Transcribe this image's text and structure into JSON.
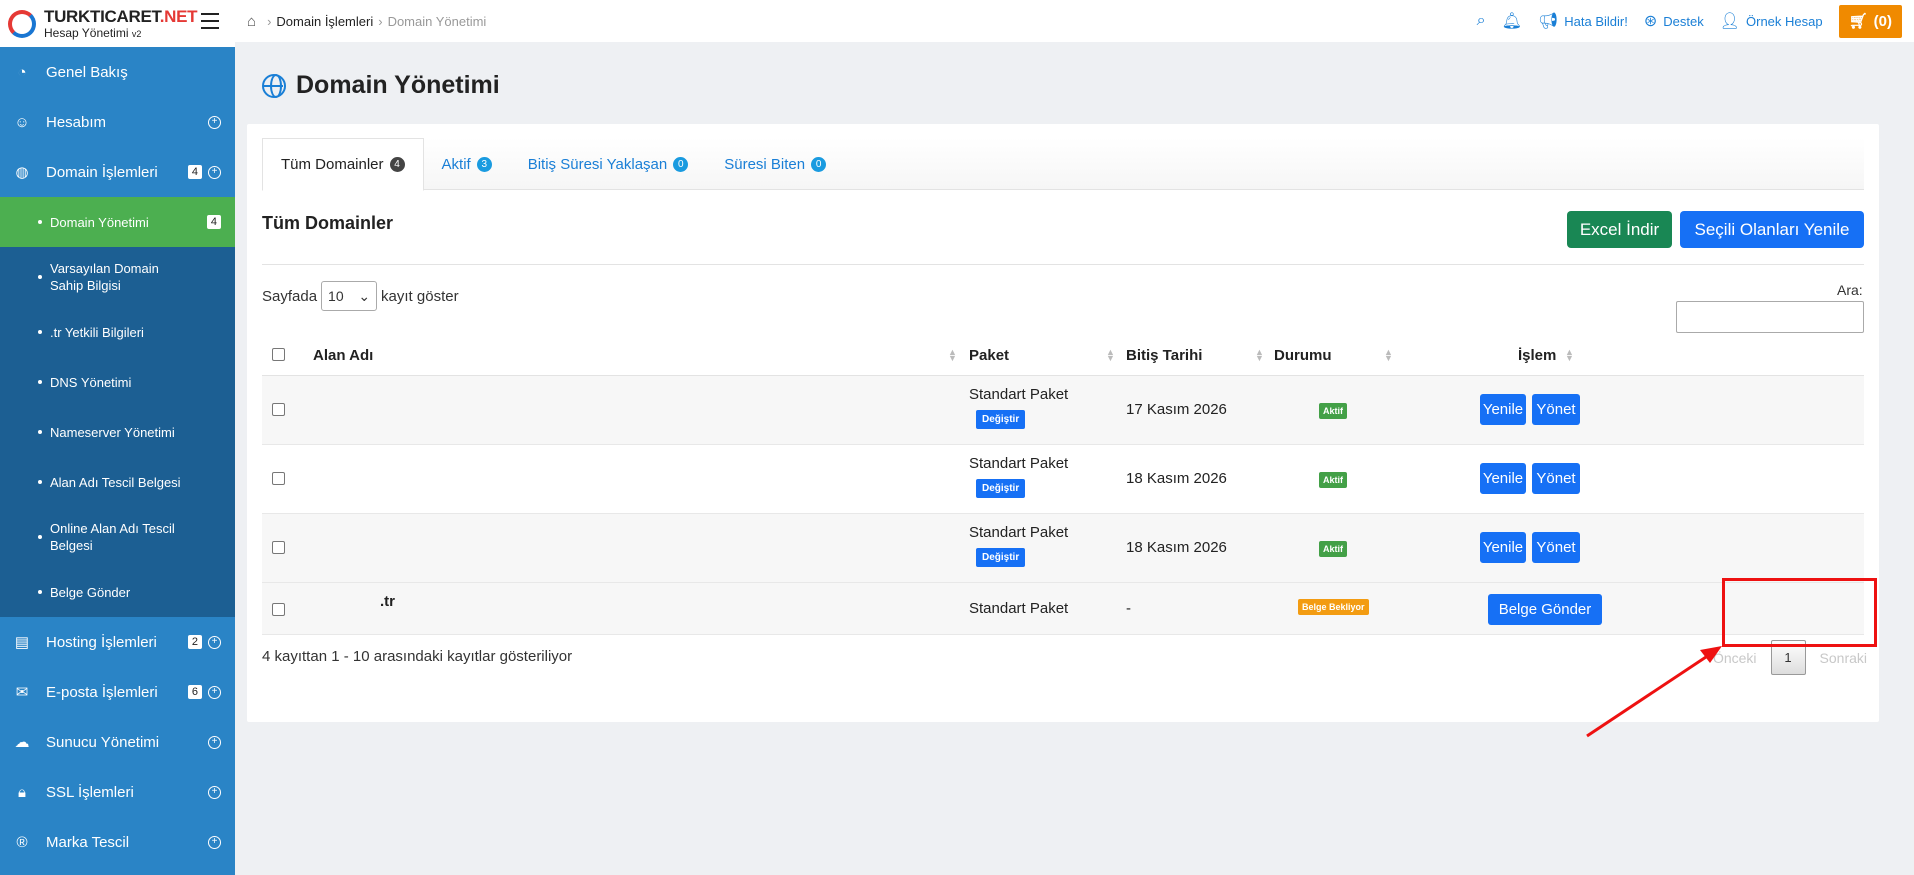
{
  "logo": {
    "name": "TURKTICARET",
    "name_suffix": ".NET",
    "subtitle": "Hesap Yönetimi",
    "version": "v2"
  },
  "sidebar": {
    "items": [
      {
        "label": "Genel Bakış",
        "icon": "gauge-icon"
      },
      {
        "label": "Hesabım",
        "icon": "user-icon"
      },
      {
        "label": "Domain İşlemleri",
        "icon": "globe-icon",
        "badge": "4"
      },
      {
        "label": "Hosting İşlemleri",
        "icon": "server-icon",
        "badge": "2"
      },
      {
        "label": "E-posta İşlemleri",
        "icon": "envelope-icon",
        "badge": "6"
      },
      {
        "label": "Sunucu Yönetimi",
        "icon": "cloud-icon"
      },
      {
        "label": "SSL İşlemleri",
        "icon": "lock-icon"
      },
      {
        "label": "Marka Tescil",
        "icon": "registered-icon"
      }
    ],
    "submenu": [
      {
        "label": "Domain Yönetimi",
        "badge": "4",
        "active": true
      },
      {
        "label": "Varsayılan Domain Sahip Bilgisi"
      },
      {
        "label": ".tr Yetkili Bilgileri"
      },
      {
        "label": "DNS Yönetimi"
      },
      {
        "label": "Nameserver Yönetimi"
      },
      {
        "label": "Alan Adı Tescil Belgesi"
      },
      {
        "label": "Online Alan Adı Tescil Belgesi"
      },
      {
        "label": "Belge Gönder"
      }
    ]
  },
  "breadcrumb": {
    "parent": "Domain İşlemleri",
    "current": "Domain Yönetimi"
  },
  "topbar": {
    "report_bug": "Hata Bildir!",
    "support": "Destek",
    "account": "Örnek Hesap",
    "cart": "(0)"
  },
  "page_title": "Domain Yönetimi",
  "tabs": [
    {
      "label": "Tüm Domainler",
      "count": "4"
    },
    {
      "label": "Aktif",
      "count": "3"
    },
    {
      "label": "Bitiş Süresi Yaklaşan",
      "count": "0"
    },
    {
      "label": "Süresi Biten",
      "count": "0"
    }
  ],
  "section_title": "Tüm Domainler",
  "buttons": {
    "excel": "Excel İndir",
    "renew_selected": "Seçili Olanları Yenile"
  },
  "length_control": {
    "prefix": "Sayfada",
    "value": "10",
    "suffix": "kayıt göster"
  },
  "search_label": "Ara:",
  "table": {
    "headers": {
      "name": "Alan Adı",
      "package": "Paket",
      "expiry": "Bitiş Tarihi",
      "status": "Durumu",
      "action": "İşlem"
    },
    "rows": [
      {
        "name": "",
        "package": "Standart Paket",
        "change": "Değiştir",
        "expiry": "17 Kasım 2026",
        "status": "Aktif",
        "renew": "Yenile",
        "manage": "Yönet"
      },
      {
        "name": "",
        "package": "Standart Paket",
        "change": "Değiştir",
        "expiry": "18 Kasım 2026",
        "status": "Aktif",
        "renew": "Yenile",
        "manage": "Yönet"
      },
      {
        "name": "",
        "package": "Standart Paket",
        "change": "Değiştir",
        "expiry": "18 Kasım 2026",
        "status": "Aktif",
        "renew": "Yenile",
        "manage": "Yönet"
      },
      {
        "name": ".tr",
        "package": "Standart Paket",
        "expiry": "-",
        "status": "Belge Bekliyor",
        "send_doc": "Belge Gönder"
      }
    ]
  },
  "info_text": "4 kayıttan 1 - 10 arasındaki kayıtlar gösteriliyor",
  "pager": {
    "prev": "Önceki",
    "page": "1",
    "next": "Sonraki"
  },
  "colors": {
    "sidebar": "#2a84c6",
    "submenu": "#1c5f93",
    "active_sub": "#4caf50",
    "primary": "#1670f5",
    "excel": "#198754",
    "cart": "#f08a00",
    "annotation": "#ee1111"
  }
}
